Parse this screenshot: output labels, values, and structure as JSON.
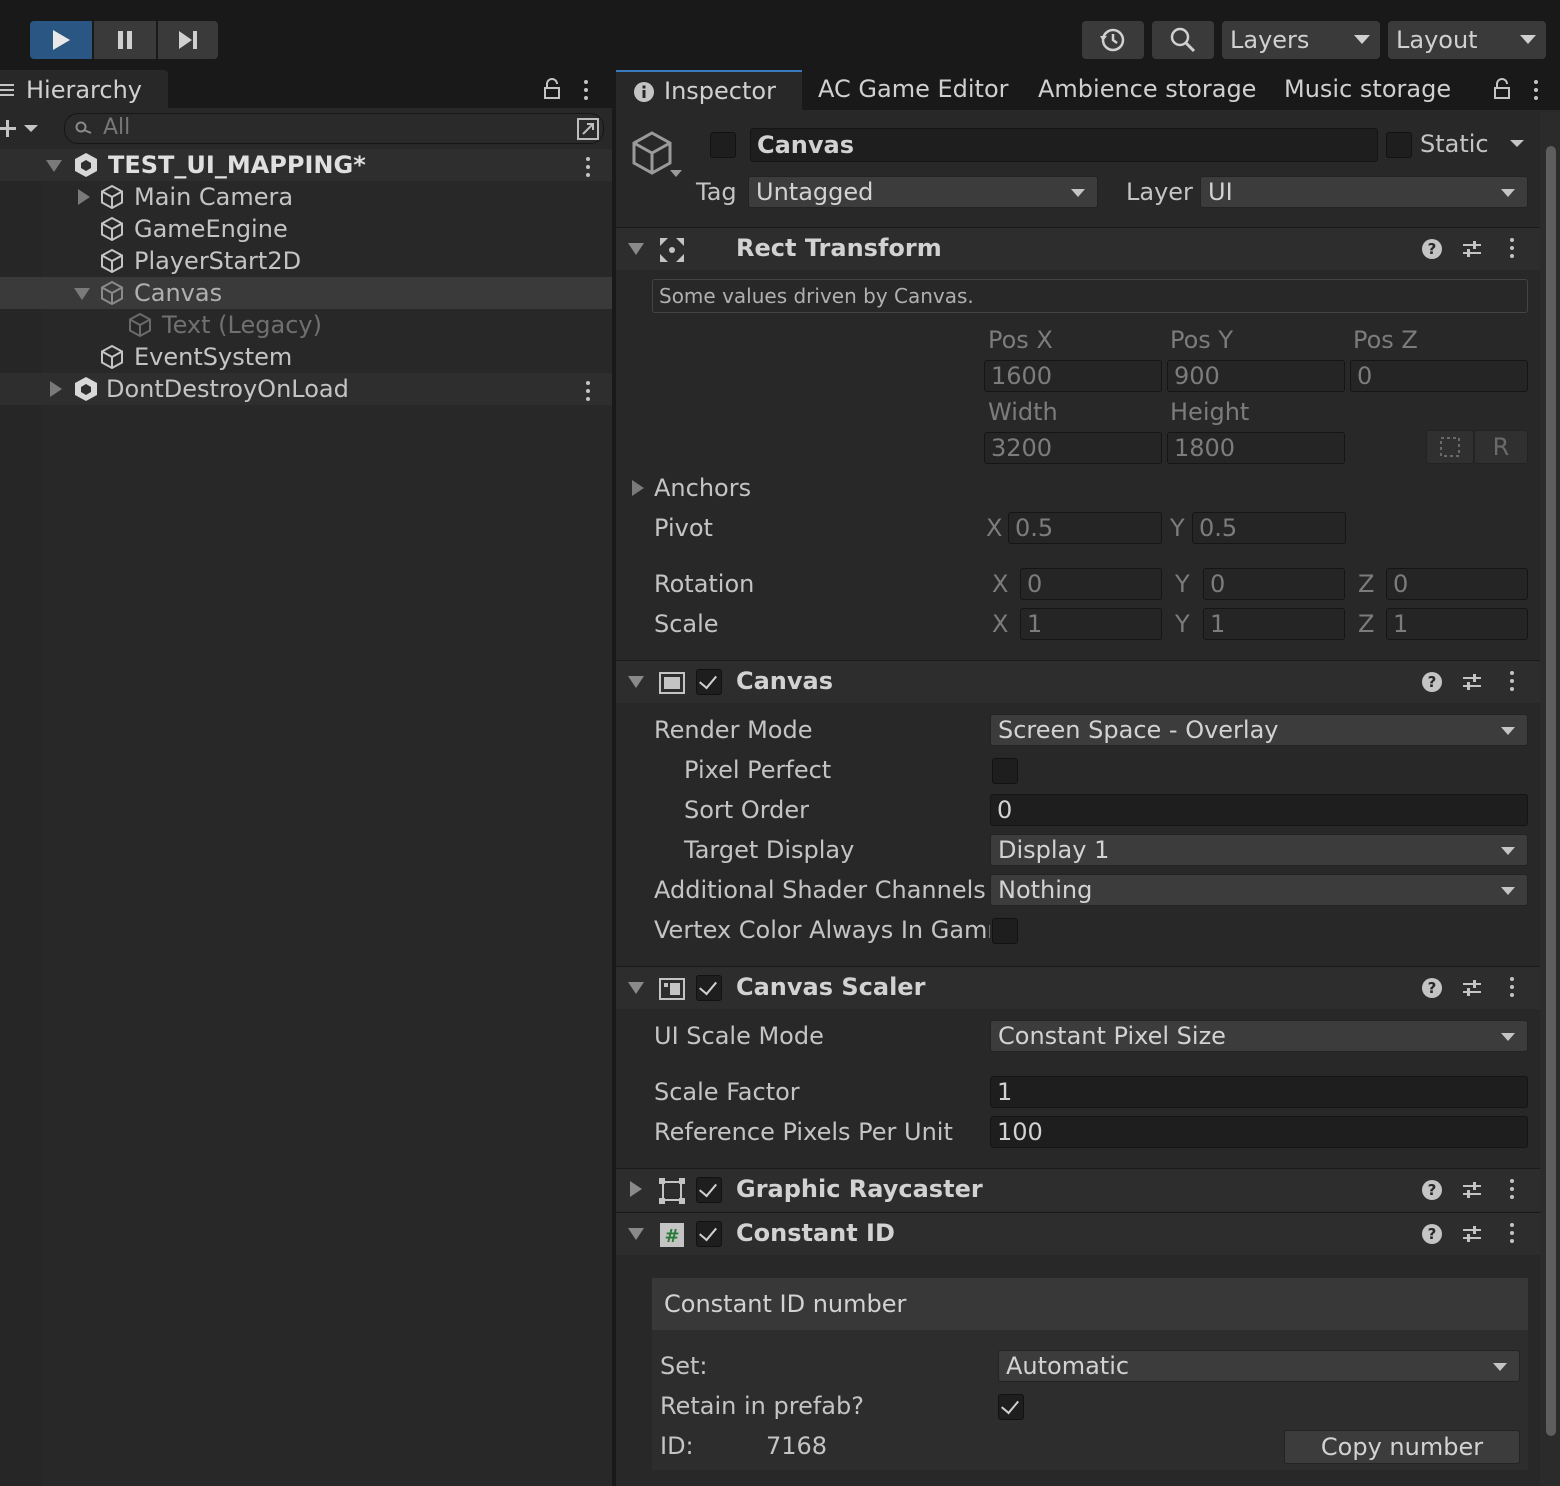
{
  "toolbar": {
    "layers_label": "Layers",
    "layout_label": "Layout",
    "accent": "#3a79bb"
  },
  "hierarchy": {
    "tab_label": "Hierarchy",
    "search_placeholder": "All",
    "items": [
      {
        "label": "TEST_UI_MAPPING*",
        "kind": "scene"
      },
      {
        "label": "Main Camera"
      },
      {
        "label": "GameEngine"
      },
      {
        "label": "PlayerStart2D"
      },
      {
        "label": "Canvas",
        "selected": true
      },
      {
        "label": "Text (Legacy)",
        "inactive": true
      },
      {
        "label": "EventSystem"
      },
      {
        "label": "DontDestroyOnLoad",
        "kind": "scene"
      }
    ]
  },
  "inspector": {
    "tabs": [
      "Inspector",
      "AC Game Editor",
      "Ambience storage",
      "Music storage"
    ],
    "object_name": "Canvas",
    "static_label": "Static",
    "tag_label": "Tag",
    "tag_value": "Untagged",
    "layer_label": "Layer",
    "layer_value": "UI",
    "rect_transform": {
      "title": "Rect Transform",
      "notice": "Some values driven by Canvas.",
      "pos_x_label": "Pos X",
      "pos_y_label": "Pos Y",
      "pos_z_label": "Pos Z",
      "pos_x": "1600",
      "pos_y": "900",
      "pos_z": "0",
      "width_label": "Width",
      "height_label": "Height",
      "width": "3200",
      "height": "1800",
      "r_button": "R",
      "anchors_label": "Anchors",
      "pivot_label": "Pivot",
      "pivot_x": "0.5",
      "pivot_y": "0.5",
      "rotation_label": "Rotation",
      "rot_x": "0",
      "rot_y": "0",
      "rot_z": "0",
      "scale_label": "Scale",
      "scale_x": "1",
      "scale_y": "1",
      "scale_z": "1",
      "x": "X",
      "y": "Y",
      "z": "Z"
    },
    "canvas": {
      "title": "Canvas",
      "render_mode_label": "Render Mode",
      "render_mode": "Screen Space - Overlay",
      "pixel_perfect_label": "Pixel Perfect",
      "sort_order_label": "Sort Order",
      "sort_order": "0",
      "target_display_label": "Target Display",
      "target_display": "Display 1",
      "shader_channels_label": "Additional Shader Channels",
      "shader_channels": "Nothing",
      "vertex_color_label": "Vertex Color Always In Gamma"
    },
    "canvas_scaler": {
      "title": "Canvas Scaler",
      "scale_mode_label": "UI Scale Mode",
      "scale_mode": "Constant Pixel Size",
      "scale_factor_label": "Scale Factor",
      "scale_factor": "1",
      "ref_ppu_label": "Reference Pixels Per Unit",
      "ref_ppu": "100"
    },
    "graphic_raycaster": {
      "title": "Graphic Raycaster"
    },
    "constant_id": {
      "title": "Constant ID",
      "box_title": "Constant ID number",
      "set_label": "Set:",
      "set_value": "Automatic",
      "retain_label": "Retain in prefab?",
      "id_label": "ID:",
      "id_value": "7168",
      "copy_button": "Copy number"
    }
  }
}
